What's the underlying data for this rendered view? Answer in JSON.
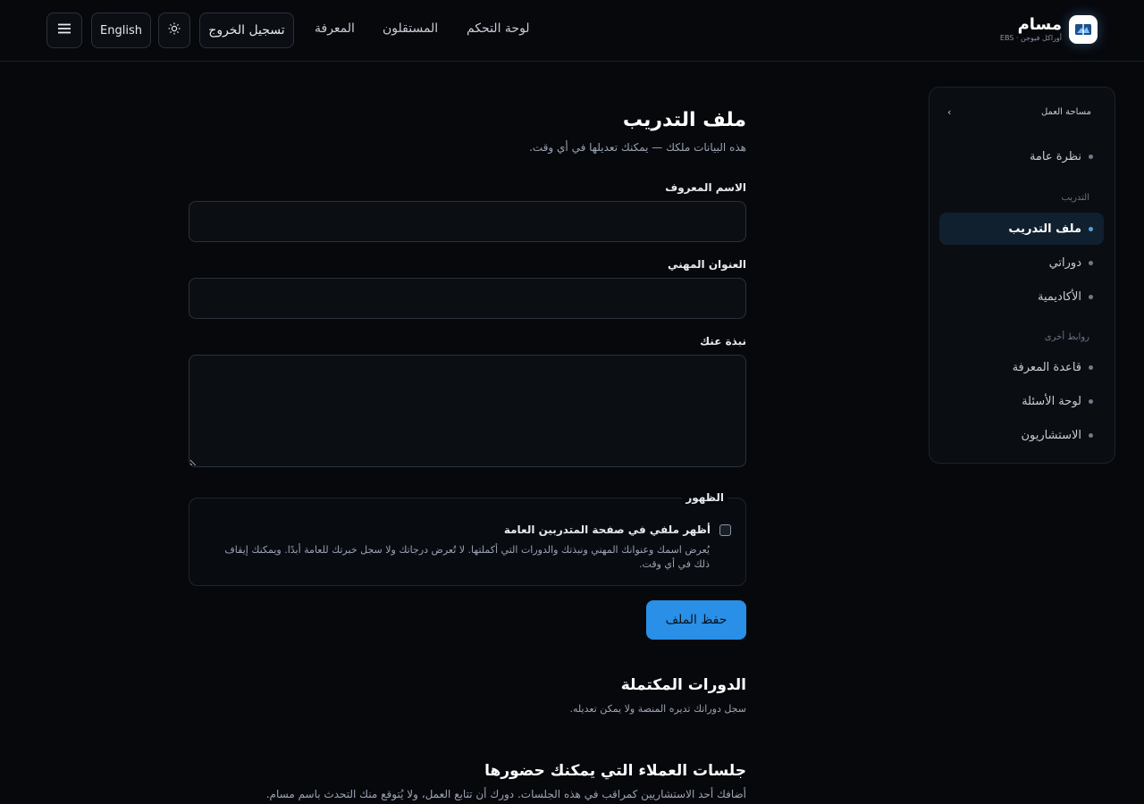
{
  "header": {
    "brand_name": "مسام",
    "brand_sub": "أوراكل فيوجن · EBS",
    "nav": [
      "لوحة التحكم",
      "المستقلون",
      "المعرفة"
    ],
    "logout_label": "تسجيل الخروج",
    "language_label": "English",
    "theme_icon": "sun-icon",
    "menu_icon": "menu-icon"
  },
  "sidebar": {
    "title": "مساحة العمل",
    "overview": "نظرة عامة",
    "group_training": "التدريب",
    "training_items": [
      "ملف التدريب",
      "دوراتي",
      "الأكاديمية"
    ],
    "active_item": "ملف التدريب",
    "group_links": "روابط أخرى",
    "link_items": [
      "قاعدة المعرفة",
      "لوحة الأسئلة",
      "الاستشاريون"
    ]
  },
  "main": {
    "title": "ملف التدريب",
    "subtitle": "هذه البيانات ملكك — يمكنك تعديلها في أي وقت.",
    "fields": {
      "display_name_label": "الاسم المعروف",
      "display_name_value": "",
      "headline_label": "العنوان المهني",
      "headline_value": "",
      "bio_label": "نبذة عنك",
      "bio_value": ""
    },
    "visibility": {
      "legend": "الظهور",
      "checkbox_label": "أظهر ملفي في صفحة المتدربين العامة",
      "checked": false,
      "help_text": "يُعرض اسمك وعنوانك المهني ونبذتك والدورات التي أكملتها. لا تُعرض درجاتك ولا سجل خبرتك للعامة أبدًا. ويمكنك إيقاف ذلك في أي وقت."
    },
    "save_label": "حفظ الملف",
    "completed": {
      "title": "الدورات المكتملة",
      "subtitle": "سجل دوراتك تديره المنصة ولا يمكن تعديله."
    },
    "sessions": {
      "title": "جلسات العملاء التي يمكنك حضورها",
      "subtitle": "أضافك أحد الاستشاريين كمراقب في هذه الجلسات. دورك أن تتابع العمل، ولا يُتوقع منك التحدث باسم مسام."
    }
  },
  "colors": {
    "background": "#06080c",
    "accent": "#2a8fe6",
    "active_bg": "#10202f"
  }
}
